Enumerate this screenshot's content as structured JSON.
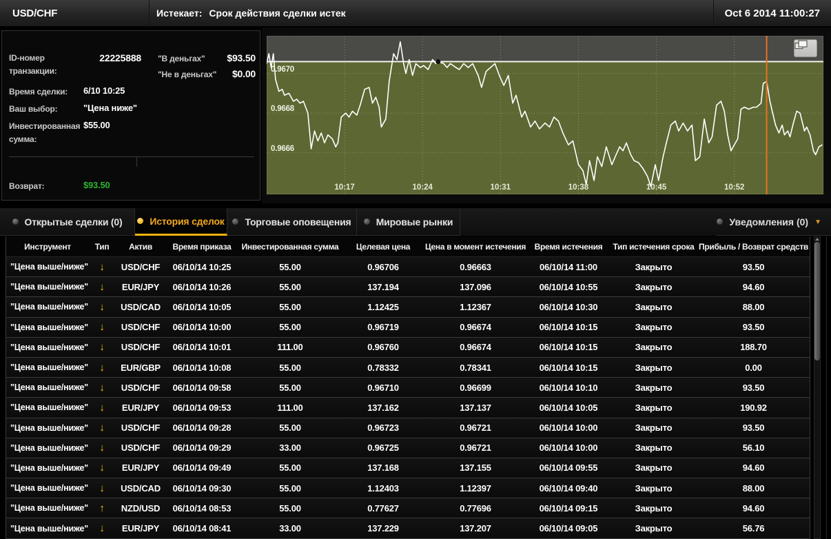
{
  "header": {
    "symbol": "USD/CHF",
    "expiry_label": "Истекает:",
    "expiry_value": "Срок действия сделки истек",
    "datetime": "Oct 6 2014  11:00:27"
  },
  "trade_panel": {
    "id_label": "ID-номер транзакции:",
    "id_value": "22225888",
    "in_money_label": "\"В деньгах\"",
    "in_money_value": "$93.50",
    "out_money_label": "\"Не в деньгах\"",
    "out_money_value": "$0.00",
    "trade_time_label": "Время сделки:",
    "trade_time_value": "6/10 10:25",
    "choice_label": "Ваш выбор:",
    "choice_value": "\"Цена ниже\"",
    "invested_label": "Инвестированная сумма:",
    "invested_value": "$55.00",
    "return_label": "Возврат:",
    "return_value": "$93.50"
  },
  "chart_data": {
    "type": "line",
    "title": "USD/CHF intraday price with target level 0.96706",
    "symbol": "USD/CHF",
    "x_axis": {
      "unit": "minutes-after-10:00",
      "tlim": [
        10,
        60
      ],
      "ticks": [
        {
          "t": 17,
          "label": "10:17"
        },
        {
          "t": 24,
          "label": "10:24"
        },
        {
          "t": 31,
          "label": "10:31"
        },
        {
          "t": 38,
          "label": "10:38"
        },
        {
          "t": 45,
          "label": "10:45"
        },
        {
          "t": 52,
          "label": "10:52"
        }
      ]
    },
    "y_axis": {
      "ylim": [
        0.96639,
        0.96719
      ],
      "ticks": [
        {
          "value": 0.967,
          "label": "0.9670"
        },
        {
          "value": 0.9668,
          "label": "0.9668"
        },
        {
          "value": 0.9666,
          "label": "0.9666"
        }
      ]
    },
    "grid": true,
    "target_price": 0.96706,
    "trade_marker": {
      "t": 25.4,
      "price": 0.96706
    },
    "expiry_line_t": 54.9,
    "colors": {
      "line": "#ffffff",
      "above_target_bg": "#4a4a47",
      "below_target_bg": "#5c6733",
      "grid": "#c9d2ae",
      "target_line": "#f2f2ee",
      "expiry_line": "#e4731f",
      "marker": "#111111"
    },
    "series": [
      {
        "name": "USD/CHF",
        "points": [
          [
            10.0,
            0.96705
          ],
          [
            10.2,
            0.9671
          ],
          [
            10.4,
            0.96703
          ],
          [
            10.6,
            0.9671
          ],
          [
            10.8,
            0.96697
          ],
          [
            11.1,
            0.96691
          ],
          [
            11.4,
            0.96692
          ],
          [
            11.6,
            0.96689
          ],
          [
            12.0,
            0.9669
          ],
          [
            12.4,
            0.96686
          ],
          [
            12.7,
            0.96687
          ],
          [
            13.0,
            0.96685
          ],
          [
            13.3,
            0.96686
          ],
          [
            13.7,
            0.9668
          ],
          [
            14.0,
            0.96662
          ],
          [
            14.3,
            0.96671
          ],
          [
            14.6,
            0.96666
          ],
          [
            14.9,
            0.9667
          ],
          [
            15.2,
            0.96665
          ],
          [
            15.5,
            0.96669
          ],
          [
            15.9,
            0.96667
          ],
          [
            16.2,
            0.96663
          ],
          [
            16.4,
            0.96665
          ],
          [
            16.7,
            0.96678
          ],
          [
            17.1,
            0.9668
          ],
          [
            17.4,
            0.96678
          ],
          [
            17.7,
            0.96681
          ],
          [
            18.1,
            0.96679
          ],
          [
            18.4,
            0.96684
          ],
          [
            18.8,
            0.96692
          ],
          [
            19.2,
            0.96693
          ],
          [
            19.5,
            0.96685
          ],
          [
            19.8,
            0.96688
          ],
          [
            20.1,
            0.96683
          ],
          [
            20.3,
            0.96673
          ],
          [
            20.7,
            0.96677
          ],
          [
            21.0,
            0.96696
          ],
          [
            21.4,
            0.9671
          ],
          [
            21.7,
            0.96707
          ],
          [
            22.0,
            0.96716
          ],
          [
            22.3,
            0.96705
          ],
          [
            22.5,
            0.967
          ],
          [
            22.8,
            0.96707
          ],
          [
            23.1,
            0.96699
          ],
          [
            23.4,
            0.96705
          ],
          [
            23.8,
            0.96703
          ],
          [
            24.1,
            0.96704
          ],
          [
            24.5,
            0.96702
          ],
          [
            24.9,
            0.96707
          ],
          [
            25.2,
            0.96705
          ],
          [
            25.4,
            0.96706
          ],
          [
            25.9,
            0.96705
          ],
          [
            26.2,
            0.96703
          ],
          [
            26.5,
            0.96705
          ],
          [
            27.0,
            0.96703
          ],
          [
            27.3,
            0.96702
          ],
          [
            27.7,
            0.96705
          ],
          [
            28.1,
            0.96703
          ],
          [
            28.5,
            0.96705
          ],
          [
            29.0,
            0.96699
          ],
          [
            29.3,
            0.96693
          ],
          [
            29.7,
            0.96701
          ],
          [
            30.1,
            0.96703
          ],
          [
            30.5,
            0.96705
          ],
          [
            30.9,
            0.96699
          ],
          [
            31.3,
            0.96694
          ],
          [
            31.7,
            0.96699
          ],
          [
            32.1,
            0.96685
          ],
          [
            32.4,
            0.96689
          ],
          [
            32.9,
            0.96678
          ],
          [
            33.2,
            0.96681
          ],
          [
            33.7,
            0.96673
          ],
          [
            34.1,
            0.96676
          ],
          [
            34.5,
            0.96672
          ],
          [
            35.0,
            0.96675
          ],
          [
            35.4,
            0.96673
          ],
          [
            35.8,
            0.96678
          ],
          [
            36.2,
            0.96676
          ],
          [
            36.6,
            0.9667
          ],
          [
            37.1,
            0.96664
          ],
          [
            37.5,
            0.96666
          ],
          [
            38.0,
            0.96654
          ],
          [
            38.4,
            0.96651
          ],
          [
            38.7,
            0.96644
          ],
          [
            39.0,
            0.96656
          ],
          [
            39.4,
            0.96646
          ],
          [
            39.7,
            0.96658
          ],
          [
            40.1,
            0.96653
          ],
          [
            40.5,
            0.96663
          ],
          [
            41.0,
            0.96654
          ],
          [
            41.3,
            0.96658
          ],
          [
            41.7,
            0.96663
          ],
          [
            42.0,
            0.96661
          ],
          [
            42.3,
            0.96665
          ],
          [
            42.7,
            0.96659
          ],
          [
            43.0,
            0.96656
          ],
          [
            43.4,
            0.96655
          ],
          [
            43.8,
            0.96652
          ],
          [
            44.2,
            0.96648
          ],
          [
            44.5,
            0.96643
          ],
          [
            44.9,
            0.96654
          ],
          [
            45.2,
            0.96646
          ],
          [
            45.6,
            0.96658
          ],
          [
            45.9,
            0.96665
          ],
          [
            46.3,
            0.96674
          ],
          [
            46.7,
            0.96676
          ],
          [
            47.0,
            0.96671
          ],
          [
            47.4,
            0.96675
          ],
          [
            47.8,
            0.96671
          ],
          [
            48.2,
            0.96674
          ],
          [
            48.5,
            0.96656
          ],
          [
            48.9,
            0.96658
          ],
          [
            49.3,
            0.96677
          ],
          [
            49.7,
            0.96665
          ],
          [
            50.0,
            0.96668
          ],
          [
            50.4,
            0.96684
          ],
          [
            50.8,
            0.96686
          ],
          [
            51.1,
            0.96681
          ],
          [
            51.4,
            0.96669
          ],
          [
            51.7,
            0.96661
          ],
          [
            52.0,
            0.96664
          ],
          [
            52.3,
            0.96667
          ],
          [
            52.6,
            0.96682
          ],
          [
            52.9,
            0.96683
          ],
          [
            53.3,
            0.96682
          ],
          [
            53.7,
            0.96683
          ],
          [
            54.0,
            0.96683
          ],
          [
            54.4,
            0.96685
          ],
          [
            54.6,
            0.96695
          ],
          [
            54.9,
            0.96696
          ],
          [
            55.2,
            0.96686
          ],
          [
            55.4,
            0.96681
          ],
          [
            55.7,
            0.96674
          ],
          [
            56.0,
            0.9667
          ],
          [
            56.3,
            0.96674
          ],
          [
            56.5,
            0.96669
          ],
          [
            56.8,
            0.96671
          ],
          [
            57.0,
            0.96668
          ],
          [
            57.3,
            0.96675
          ],
          [
            57.6,
            0.96681
          ],
          [
            57.9,
            0.9668
          ],
          [
            58.3,
            0.96671
          ],
          [
            58.5,
            0.96673
          ],
          [
            58.8,
            0.96669
          ],
          [
            59.1,
            0.96661
          ],
          [
            59.3,
            0.96659
          ],
          [
            59.6,
            0.96663
          ],
          [
            59.9,
            0.96664
          ]
        ]
      }
    ]
  },
  "tabs": {
    "items": [
      {
        "label": "Открытые сделки (0)",
        "active": false
      },
      {
        "label": "История сделок",
        "active": true
      },
      {
        "label": "Торговые оповещения",
        "active": false
      },
      {
        "label": "Мировые рынки",
        "active": false
      }
    ],
    "notifications_label": "Уведомления (0)",
    "dropdown_icon": "▼"
  },
  "table": {
    "columns": [
      "Инструмент",
      "Тип",
      "Актив",
      "Время приказа",
      "Инвестированная сумма",
      "Целевая цена",
      "Цена в момент истечения",
      "Время истечения",
      "Тип истечения срока",
      "Прибыль / Возврат средств"
    ],
    "arrow_glyphs": {
      "down": "↓",
      "up": "↑"
    },
    "rows": [
      {
        "instrument": "\"Цена выше/ниже\"",
        "direction": "down",
        "asset": "USD/CHF",
        "order_time": "06/10/14 10:25",
        "amount": "55.00",
        "target_price": "0.96706",
        "expiry_price": "0.96663",
        "expiry_time": "06/10/14 11:00",
        "expiry_type": "Закрыто",
        "payout": "93.50"
      },
      {
        "instrument": "\"Цена выше/ниже\"",
        "direction": "down",
        "asset": "EUR/JPY",
        "order_time": "06/10/14 10:26",
        "amount": "55.00",
        "target_price": "137.194",
        "expiry_price": "137.096",
        "expiry_time": "06/10/14 10:55",
        "expiry_type": "Закрыто",
        "payout": "94.60"
      },
      {
        "instrument": "\"Цена выше/ниже\"",
        "direction": "down",
        "asset": "USD/CAD",
        "order_time": "06/10/14 10:05",
        "amount": "55.00",
        "target_price": "1.12425",
        "expiry_price": "1.12367",
        "expiry_time": "06/10/14 10:30",
        "expiry_type": "Закрыто",
        "payout": "88.00"
      },
      {
        "instrument": "\"Цена выше/ниже\"",
        "direction": "down",
        "asset": "USD/CHF",
        "order_time": "06/10/14 10:00",
        "amount": "55.00",
        "target_price": "0.96719",
        "expiry_price": "0.96674",
        "expiry_time": "06/10/14 10:15",
        "expiry_type": "Закрыто",
        "payout": "93.50"
      },
      {
        "instrument": "\"Цена выше/ниже\"",
        "direction": "down",
        "asset": "USD/CHF",
        "order_time": "06/10/14 10:01",
        "amount": "111.00",
        "target_price": "0.96760",
        "expiry_price": "0.96674",
        "expiry_time": "06/10/14 10:15",
        "expiry_type": "Закрыто",
        "payout": "188.70"
      },
      {
        "instrument": "\"Цена выше/ниже\"",
        "direction": "down",
        "asset": "EUR/GBP",
        "order_time": "06/10/14 10:08",
        "amount": "55.00",
        "target_price": "0.78332",
        "expiry_price": "0.78341",
        "expiry_time": "06/10/14 10:15",
        "expiry_type": "Закрыто",
        "payout": "0.00"
      },
      {
        "instrument": "\"Цена выше/ниже\"",
        "direction": "down",
        "asset": "USD/CHF",
        "order_time": "06/10/14 09:58",
        "amount": "55.00",
        "target_price": "0.96710",
        "expiry_price": "0.96699",
        "expiry_time": "06/10/14 10:10",
        "expiry_type": "Закрыто",
        "payout": "93.50"
      },
      {
        "instrument": "\"Цена выше/ниже\"",
        "direction": "down",
        "asset": "EUR/JPY",
        "order_time": "06/10/14 09:53",
        "amount": "111.00",
        "target_price": "137.162",
        "expiry_price": "137.137",
        "expiry_time": "06/10/14 10:05",
        "expiry_type": "Закрыто",
        "payout": "190.92"
      },
      {
        "instrument": "\"Цена выше/ниже\"",
        "direction": "down",
        "asset": "USD/CHF",
        "order_time": "06/10/14 09:28",
        "amount": "55.00",
        "target_price": "0.96723",
        "expiry_price": "0.96721",
        "expiry_time": "06/10/14 10:00",
        "expiry_type": "Закрыто",
        "payout": "93.50"
      },
      {
        "instrument": "\"Цена выше/ниже\"",
        "direction": "down",
        "asset": "USD/CHF",
        "order_time": "06/10/14 09:29",
        "amount": "33.00",
        "target_price": "0.96725",
        "expiry_price": "0.96721",
        "expiry_time": "06/10/14 10:00",
        "expiry_type": "Закрыто",
        "payout": "56.10"
      },
      {
        "instrument": "\"Цена выше/ниже\"",
        "direction": "down",
        "asset": "EUR/JPY",
        "order_time": "06/10/14 09:49",
        "amount": "55.00",
        "target_price": "137.168",
        "expiry_price": "137.155",
        "expiry_time": "06/10/14 09:55",
        "expiry_type": "Закрыто",
        "payout": "94.60"
      },
      {
        "instrument": "\"Цена выше/ниже\"",
        "direction": "down",
        "asset": "USD/CAD",
        "order_time": "06/10/14 09:30",
        "amount": "55.00",
        "target_price": "1.12403",
        "expiry_price": "1.12397",
        "expiry_time": "06/10/14 09:40",
        "expiry_type": "Закрыто",
        "payout": "88.00"
      },
      {
        "instrument": "\"Цена выше/ниже\"",
        "direction": "up",
        "asset": "NZD/USD",
        "order_time": "06/10/14 08:53",
        "amount": "55.00",
        "target_price": "0.77627",
        "expiry_price": "0.77696",
        "expiry_time": "06/10/14 09:15",
        "expiry_type": "Закрыто",
        "payout": "94.60"
      },
      {
        "instrument": "\"Цена выше/ниже\"",
        "direction": "down",
        "asset": "EUR/JPY",
        "order_time": "06/10/14 08:41",
        "amount": "33.00",
        "target_price": "137.229",
        "expiry_price": "137.207",
        "expiry_time": "06/10/14 09:05",
        "expiry_type": "Закрыто",
        "payout": "56.76"
      }
    ]
  }
}
